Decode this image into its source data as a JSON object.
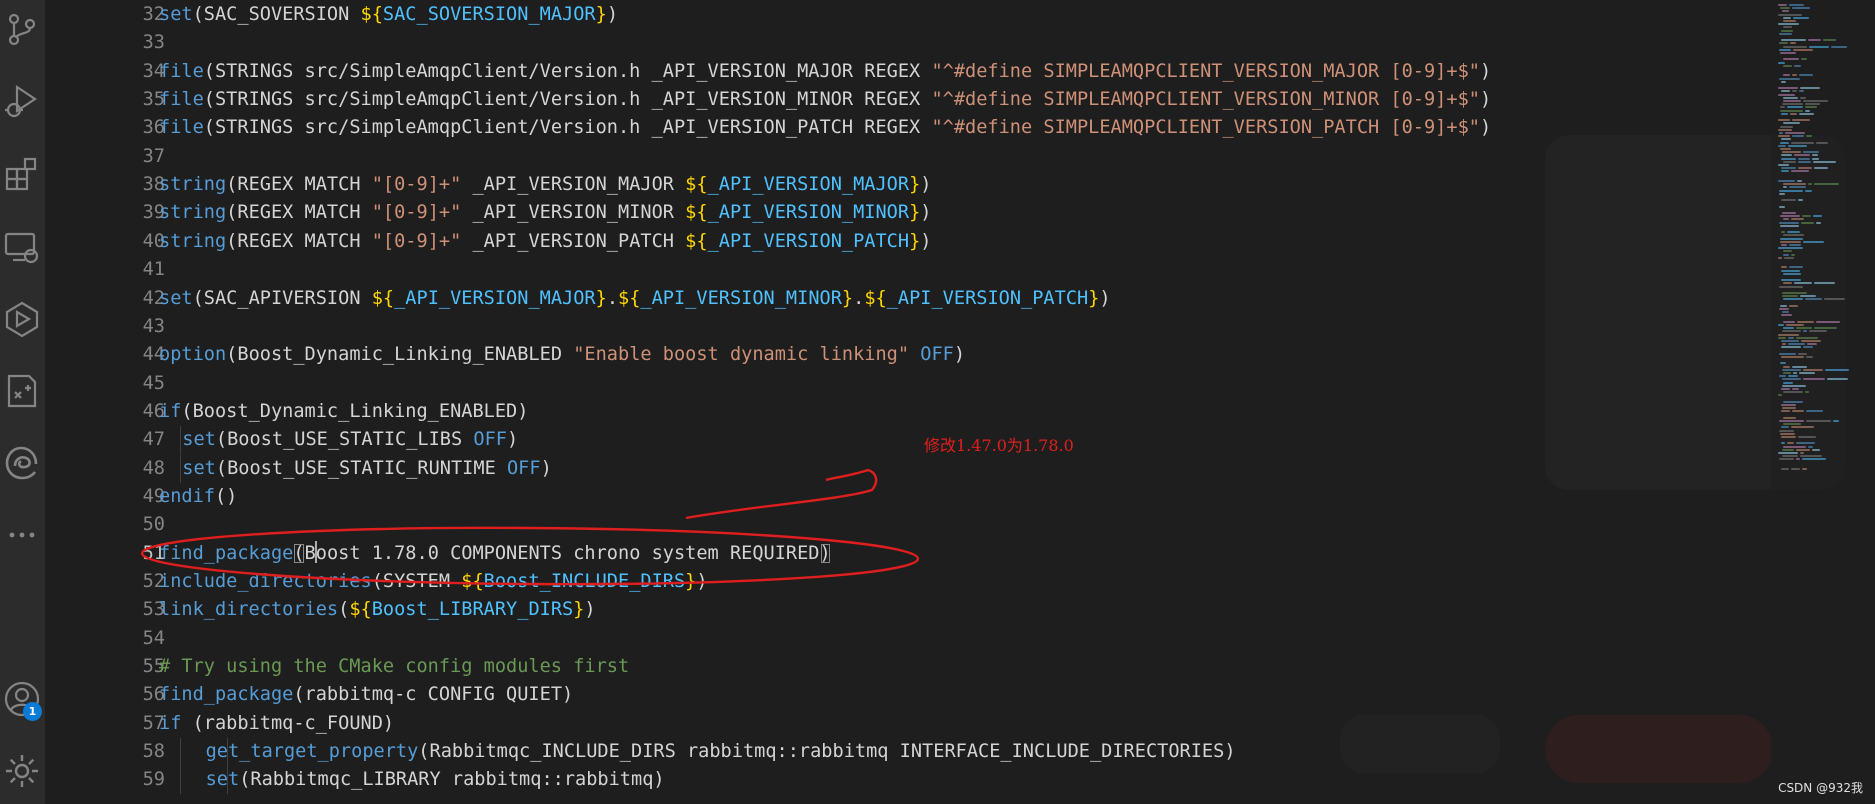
{
  "activity_bar": {
    "icons": [
      "source-control-icon",
      "run-debug-icon",
      "extensions-icon",
      "remote-explorer-icon",
      "cmake-icon",
      "test-icon",
      "edge-icon",
      "more-icon",
      "account-icon",
      "settings-icon"
    ],
    "account_badge": "1"
  },
  "colors": {
    "background": "#1e1e1e",
    "keyword": "#569cd6",
    "string": "#ce9178",
    "variable": "#4fc1ff",
    "brace": "#ffd700",
    "comment": "#6a9955",
    "annotation": "#e01e1e"
  },
  "editor": {
    "current_line": "51",
    "lines": [
      {
        "n": "32",
        "segments": [
          [
            "kw",
            "set"
          ],
          [
            "par",
            "("
          ],
          [
            "",
            "SAC_SOVERSION "
          ],
          [
            "brc",
            "${"
          ],
          [
            "var",
            "SAC_SOVERSION_MAJOR"
          ],
          [
            "brc",
            "}"
          ],
          [
            "par",
            ")"
          ]
        ]
      },
      {
        "n": "33",
        "segments": []
      },
      {
        "n": "34",
        "segments": [
          [
            "kw",
            "file"
          ],
          [
            "par",
            "("
          ],
          [
            "",
            "STRINGS src/SimpleAmqpClient/Version.h _API_VERSION_MAJOR REGEX "
          ],
          [
            "str",
            "\"^#define SIMPLEAMQPCLIENT_VERSION_MAJOR [0-9]+$\""
          ],
          [
            "par",
            ")"
          ]
        ]
      },
      {
        "n": "35",
        "segments": [
          [
            "kw",
            "file"
          ],
          [
            "par",
            "("
          ],
          [
            "",
            "STRINGS src/SimpleAmqpClient/Version.h _API_VERSION_MINOR REGEX "
          ],
          [
            "str",
            "\"^#define SIMPLEAMQPCLIENT_VERSION_MINOR [0-9]+$\""
          ],
          [
            "par",
            ")"
          ]
        ]
      },
      {
        "n": "36",
        "segments": [
          [
            "kw",
            "file"
          ],
          [
            "par",
            "("
          ],
          [
            "",
            "STRINGS src/SimpleAmqpClient/Version.h _API_VERSION_PATCH REGEX "
          ],
          [
            "str",
            "\"^#define SIMPLEAMQPCLIENT_VERSION_PATCH [0-9]+$\""
          ],
          [
            "par",
            ")"
          ]
        ]
      },
      {
        "n": "37",
        "segments": []
      },
      {
        "n": "38",
        "segments": [
          [
            "kw",
            "string"
          ],
          [
            "par",
            "("
          ],
          [
            "",
            "REGEX MATCH "
          ],
          [
            "str",
            "\"[0-9]+\""
          ],
          [
            "",
            " _API_VERSION_MAJOR "
          ],
          [
            "brc",
            "${"
          ],
          [
            "var",
            "_API_VERSION_MAJOR"
          ],
          [
            "brc",
            "}"
          ],
          [
            "par",
            ")"
          ]
        ]
      },
      {
        "n": "39",
        "segments": [
          [
            "kw",
            "string"
          ],
          [
            "par",
            "("
          ],
          [
            "",
            "REGEX MATCH "
          ],
          [
            "str",
            "\"[0-9]+\""
          ],
          [
            "",
            " _API_VERSION_MINOR "
          ],
          [
            "brc",
            "${"
          ],
          [
            "var",
            "_API_VERSION_MINOR"
          ],
          [
            "brc",
            "}"
          ],
          [
            "par",
            ")"
          ]
        ]
      },
      {
        "n": "40",
        "segments": [
          [
            "kw",
            "string"
          ],
          [
            "par",
            "("
          ],
          [
            "",
            "REGEX MATCH "
          ],
          [
            "str",
            "\"[0-9]+\""
          ],
          [
            "",
            " _API_VERSION_PATCH "
          ],
          [
            "brc",
            "${"
          ],
          [
            "var",
            "_API_VERSION_PATCH"
          ],
          [
            "brc",
            "}"
          ],
          [
            "par",
            ")"
          ]
        ]
      },
      {
        "n": "41",
        "segments": []
      },
      {
        "n": "42",
        "segments": [
          [
            "kw",
            "set"
          ],
          [
            "par",
            "("
          ],
          [
            "",
            "SAC_APIVERSION "
          ],
          [
            "brc",
            "${"
          ],
          [
            "var",
            "_API_VERSION_MAJOR"
          ],
          [
            "brc",
            "}"
          ],
          [
            "",
            "."
          ],
          [
            "brc",
            "${"
          ],
          [
            "var",
            "_API_VERSION_MINOR"
          ],
          [
            "brc",
            "}"
          ],
          [
            "",
            "."
          ],
          [
            "brc",
            "${"
          ],
          [
            "var",
            "_API_VERSION_PATCH"
          ],
          [
            "brc",
            "}"
          ],
          [
            "par",
            ")"
          ]
        ]
      },
      {
        "n": "43",
        "segments": []
      },
      {
        "n": "44",
        "segments": [
          [
            "kw",
            "option"
          ],
          [
            "par",
            "("
          ],
          [
            "",
            "Boost_Dynamic_Linking_ENABLED "
          ],
          [
            "str",
            "\"Enable boost dynamic linking\""
          ],
          [
            "",
            " "
          ],
          [
            "kw",
            "OFF"
          ],
          [
            "par",
            ")"
          ]
        ]
      },
      {
        "n": "45",
        "segments": []
      },
      {
        "n": "46",
        "segments": [
          [
            "kw",
            "if"
          ],
          [
            "par",
            "("
          ],
          [
            "",
            "Boost_Dynamic_Linking_ENABLED"
          ],
          [
            "par",
            ")"
          ]
        ]
      },
      {
        "n": "47",
        "indent": 1,
        "segments": [
          [
            "kw",
            "set"
          ],
          [
            "par",
            "("
          ],
          [
            "",
            "Boost_USE_STATIC_LIBS "
          ],
          [
            "kw",
            "OFF"
          ],
          [
            "par",
            ")"
          ]
        ]
      },
      {
        "n": "48",
        "indent": 1,
        "segments": [
          [
            "kw",
            "set"
          ],
          [
            "par",
            "("
          ],
          [
            "",
            "Boost_USE_STATIC_RUNTIME "
          ],
          [
            "kw",
            "OFF"
          ],
          [
            "par",
            ")"
          ]
        ]
      },
      {
        "n": "49",
        "segments": [
          [
            "kw",
            "endif"
          ],
          [
            "par",
            "()"
          ]
        ]
      },
      {
        "n": "50",
        "segments": []
      },
      {
        "n": "51",
        "cursor_after": 14,
        "segments": [
          [
            "kw",
            "find_package"
          ],
          [
            "par",
            "("
          ],
          [
            "",
            "Boost 1.78.0 COMPONENTS chrono system REQUIRED"
          ],
          [
            "par",
            ")"
          ]
        ]
      },
      {
        "n": "52",
        "segments": [
          [
            "kw",
            "include_directories"
          ],
          [
            "par",
            "("
          ],
          [
            "",
            "SYSTEM "
          ],
          [
            "brc",
            "${"
          ],
          [
            "var",
            "Boost_INCLUDE_DIRS"
          ],
          [
            "brc",
            "}"
          ],
          [
            "par",
            ")"
          ]
        ]
      },
      {
        "n": "53",
        "segments": [
          [
            "kw",
            "link_directories"
          ],
          [
            "par",
            "("
          ],
          [
            "brc",
            "${"
          ],
          [
            "var",
            "Boost_LIBRARY_DIRS"
          ],
          [
            "brc",
            "}"
          ],
          [
            "par",
            ")"
          ]
        ]
      },
      {
        "n": "54",
        "segments": []
      },
      {
        "n": "55",
        "segments": [
          [
            "cmt",
            "# Try using the CMake config modules first"
          ]
        ]
      },
      {
        "n": "56",
        "segments": [
          [
            "kw",
            "find_package"
          ],
          [
            "par",
            "("
          ],
          [
            "",
            "rabbitmq-c CONFIG QUIET"
          ],
          [
            "par",
            ")"
          ]
        ]
      },
      {
        "n": "57",
        "segments": [
          [
            "kw",
            "if"
          ],
          [
            "",
            " "
          ],
          [
            "par",
            "("
          ],
          [
            "",
            "rabbitmq-c_FOUND"
          ],
          [
            "par",
            ")"
          ]
        ]
      },
      {
        "n": "58",
        "indent": 2,
        "segments": [
          [
            "kw",
            "get_target_property"
          ],
          [
            "par",
            "("
          ],
          [
            "",
            "Rabbitmqc_INCLUDE_DIRS rabbitmq::rabbitmq INTERFACE_INCLUDE_DIRECTORIES"
          ],
          [
            "par",
            ")"
          ]
        ]
      },
      {
        "n": "59",
        "indent": 2,
        "segments": [
          [
            "kw",
            "set"
          ],
          [
            "par",
            "("
          ],
          [
            "",
            "Rabbitmqc_LIBRARY rabbitmq::rabbitmq"
          ],
          [
            "par",
            ")"
          ]
        ]
      }
    ]
  },
  "annotation": {
    "note": "修改1.47.0为1.78.0"
  },
  "watermark": "CSDN @932我"
}
